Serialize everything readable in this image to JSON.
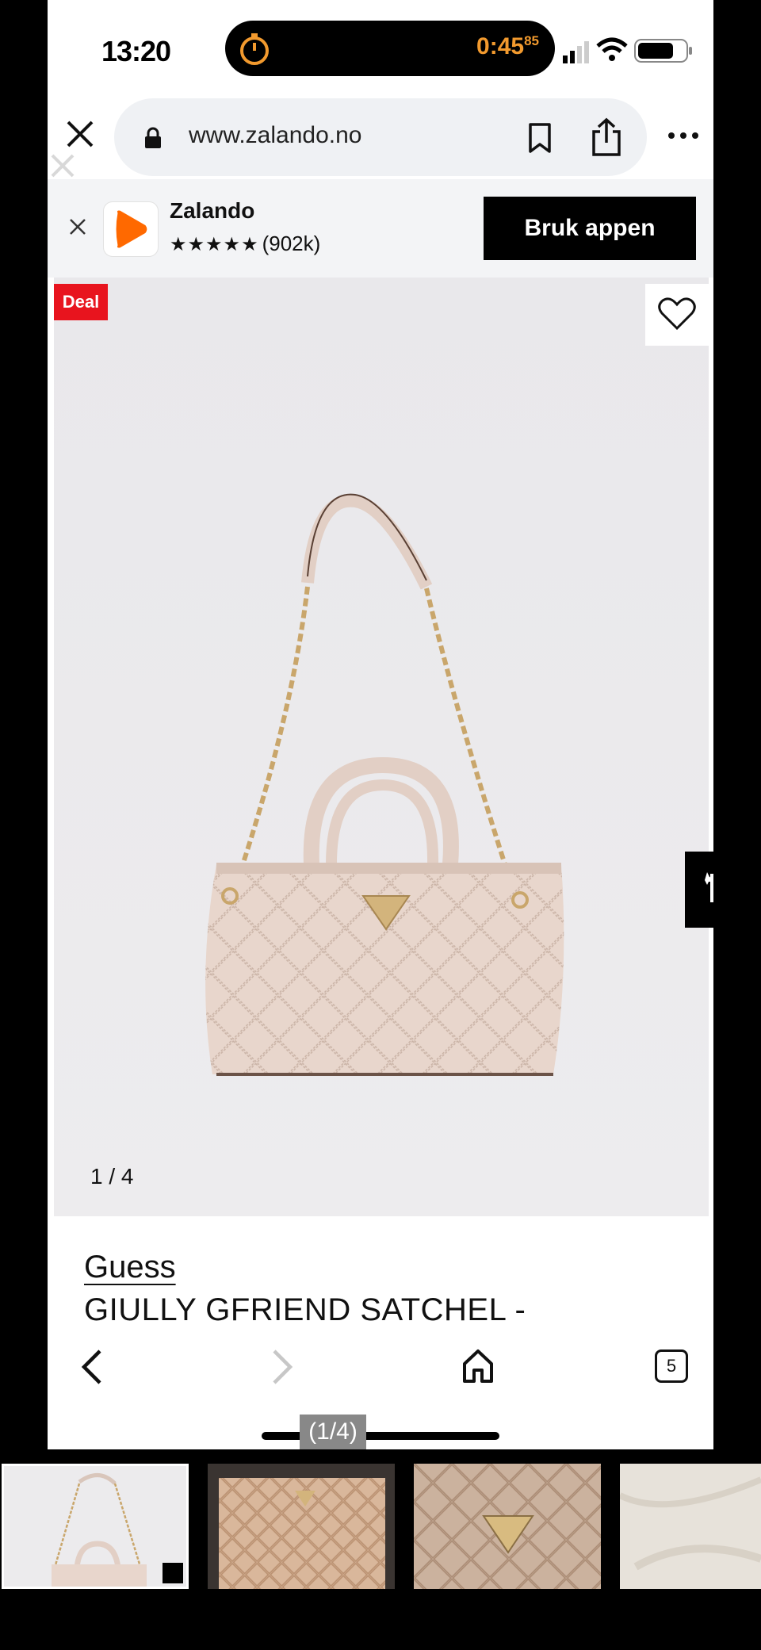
{
  "status_bar": {
    "time": "13:20",
    "timer": "0:45",
    "timer_fraction": "85"
  },
  "browser": {
    "url": "www.zalando.no"
  },
  "app_banner": {
    "app_name": "Zalando",
    "stars": "★★★★★",
    "reviews": "(902k)",
    "cta": "Bruk appen"
  },
  "product": {
    "badge": "Deal",
    "image_counter": "1 / 4",
    "brand": "Guess",
    "name": "GIULLY GFRIEND SATCHEL -"
  },
  "toolbar": {
    "tab_count": "5"
  },
  "gallery": {
    "pager": "(1/4)",
    "thumbs": [
      "thumb-1",
      "thumb-2",
      "thumb-3",
      "thumb-4"
    ]
  },
  "colors": {
    "deal": "#e8141e",
    "zalando_orange": "#ff6900",
    "timer_orange": "#f29a2e",
    "bag": "#e8d6cc",
    "product_bg": "#ebeaec"
  },
  "icons": [
    "close-icon",
    "lock-icon",
    "bookmark-icon",
    "share-icon",
    "more-icon",
    "heart-icon",
    "crop-icon",
    "back-icon",
    "forward-icon",
    "home-icon",
    "tabs-icon"
  ]
}
